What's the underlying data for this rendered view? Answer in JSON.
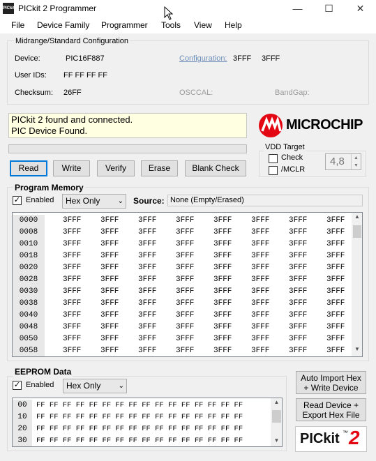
{
  "window": {
    "icon_text": "PICkit",
    "title": "PICkit 2 Programmer",
    "minimize": "—",
    "maximize": "☐",
    "close": "✕"
  },
  "menu": [
    "File",
    "Device Family",
    "Programmer",
    "Tools",
    "View",
    "Help"
  ],
  "config": {
    "group_title": "Midrange/Standard Configuration",
    "device_label": "Device:",
    "device_value": "PIC16F887",
    "configuration_label": "Configuration:",
    "config_values": [
      "3FFF",
      "3FFF"
    ],
    "userids_label": "User IDs:",
    "userids_value": "FF FF FF FF",
    "checksum_label": "Checksum:",
    "checksum_value": "26FF",
    "osccal_label": "OSCCAL:",
    "bandgap_label": "BandGap:"
  },
  "status": {
    "line1": "PICkit 2 found and connected.",
    "line2": "PIC Device Found.",
    "progress": 0
  },
  "logo": {
    "text": "MICROCHIP",
    "brand_color": "#e30613"
  },
  "buttons": [
    "Read",
    "Write",
    "Verify",
    "Erase",
    "Blank Check"
  ],
  "vdd": {
    "title": "VDD Target",
    "check_label": "Check",
    "mclr_label": "/MCLR",
    "value": "4,8"
  },
  "program_memory": {
    "title": "Program Memory",
    "enabled_label": "Enabled",
    "enabled": true,
    "mode": "Hex Only",
    "source_label": "Source:",
    "source_value": "None (Empty/Erased)",
    "rows": [
      {
        "addr": "0000",
        "cells": [
          "3FFF",
          "3FFF",
          "3FFF",
          "3FFF",
          "3FFF",
          "3FFF",
          "3FFF",
          "3FFF"
        ]
      },
      {
        "addr": "0008",
        "cells": [
          "3FFF",
          "3FFF",
          "3FFF",
          "3FFF",
          "3FFF",
          "3FFF",
          "3FFF",
          "3FFF"
        ]
      },
      {
        "addr": "0010",
        "cells": [
          "3FFF",
          "3FFF",
          "3FFF",
          "3FFF",
          "3FFF",
          "3FFF",
          "3FFF",
          "3FFF"
        ]
      },
      {
        "addr": "0018",
        "cells": [
          "3FFF",
          "3FFF",
          "3FFF",
          "3FFF",
          "3FFF",
          "3FFF",
          "3FFF",
          "3FFF"
        ]
      },
      {
        "addr": "0020",
        "cells": [
          "3FFF",
          "3FFF",
          "3FFF",
          "3FFF",
          "3FFF",
          "3FFF",
          "3FFF",
          "3FFF"
        ]
      },
      {
        "addr": "0028",
        "cells": [
          "3FFF",
          "3FFF",
          "3FFF",
          "3FFF",
          "3FFF",
          "3FFF",
          "3FFF",
          "3FFF"
        ]
      },
      {
        "addr": "0030",
        "cells": [
          "3FFF",
          "3FFF",
          "3FFF",
          "3FFF",
          "3FFF",
          "3FFF",
          "3FFF",
          "3FFF"
        ]
      },
      {
        "addr": "0038",
        "cells": [
          "3FFF",
          "3FFF",
          "3FFF",
          "3FFF",
          "3FFF",
          "3FFF",
          "3FFF",
          "3FFF"
        ]
      },
      {
        "addr": "0040",
        "cells": [
          "3FFF",
          "3FFF",
          "3FFF",
          "3FFF",
          "3FFF",
          "3FFF",
          "3FFF",
          "3FFF"
        ]
      },
      {
        "addr": "0048",
        "cells": [
          "3FFF",
          "3FFF",
          "3FFF",
          "3FFF",
          "3FFF",
          "3FFF",
          "3FFF",
          "3FFF"
        ]
      },
      {
        "addr": "0050",
        "cells": [
          "3FFF",
          "3FFF",
          "3FFF",
          "3FFF",
          "3FFF",
          "3FFF",
          "3FFF",
          "3FFF"
        ]
      },
      {
        "addr": "0058",
        "cells": [
          "3FFF",
          "3FFF",
          "3FFF",
          "3FFF",
          "3FFF",
          "3FFF",
          "3FFF",
          "3FFF"
        ]
      }
    ]
  },
  "eeprom": {
    "title": "EEPROM Data",
    "enabled_label": "Enabled",
    "enabled": true,
    "mode": "Hex Only",
    "rows": [
      {
        "addr": "00",
        "bytes": "FF FF FF FF FF FF FF FF FF FF FF FF FF FF FF FF"
      },
      {
        "addr": "10",
        "bytes": "FF FF FF FF FF FF FF FF FF FF FF FF FF FF FF FF"
      },
      {
        "addr": "20",
        "bytes": "FF FF FF FF FF FF FF FF FF FF FF FF FF FF FF FF"
      },
      {
        "addr": "30",
        "bytes": "FF FF FF FF FF FF FF FF FF FF FF FF FF FF FF FF"
      }
    ]
  },
  "side_buttons": {
    "auto_import": "Auto Import Hex\n+ Write Device",
    "read_export": "Read Device +\nExport Hex File"
  },
  "pickit_logo": {
    "text": "PICkit",
    "tm": "™",
    "number": "2"
  }
}
